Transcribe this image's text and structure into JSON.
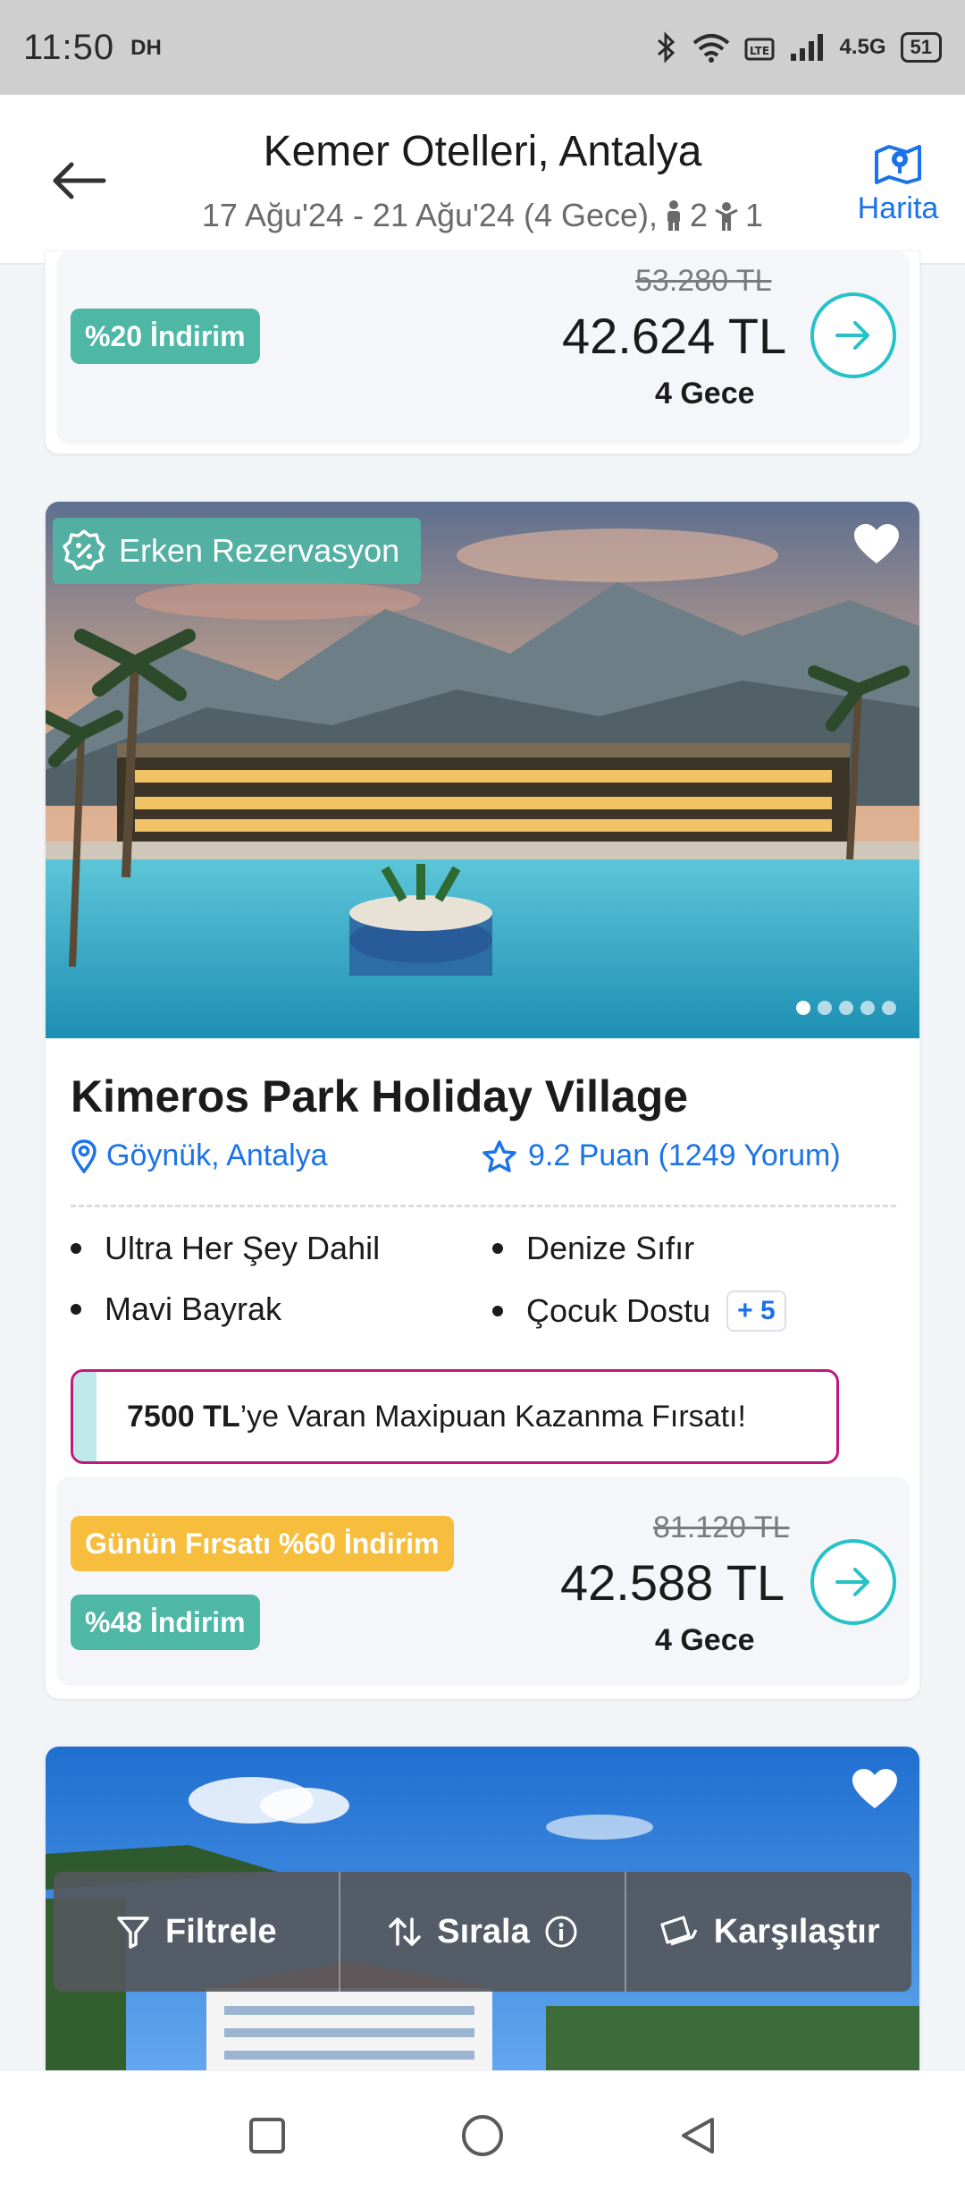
{
  "status_bar": {
    "time": "11:50",
    "carrier": "DH",
    "network": "4.5G",
    "battery": "51"
  },
  "header": {
    "title": "Kemer Otelleri, Antalya",
    "dates": "17 Ağu'24 - 21 Ağu'24 (4 Gece),",
    "adults": "2",
    "children": "1",
    "map_label": "Harita"
  },
  "top_card": {
    "discount": "%20 İndirim",
    "old_price": "53.280 TL",
    "price": "42.624 TL",
    "nights": "4 Gece"
  },
  "hotel_card": {
    "early_booking": "Erken Rezervasyon",
    "name": "Kimeros Park Holiday Village",
    "location": "Göynük, Antalya",
    "rating": "9.2 Puan (1249 Yorum)",
    "features": [
      "Ultra Her Şey Dahil",
      "Denize Sıfır",
      "Mavi Bayrak",
      "Çocuk Dostu"
    ],
    "more_features": "+ 5",
    "maxipuan_amount": "7500 TL",
    "maxipuan_text": "’ye Varan Maxipuan Kazanma Fırsatı!",
    "deal_badge": "Günün Fırsatı %60 İndirim",
    "discount": "%48 İndirim",
    "old_price": "81.120 TL",
    "price": "42.588 TL",
    "nights": "4 Gece"
  },
  "bottom_bar": {
    "filter": "Filtrele",
    "sort": "Sırala",
    "compare": "Karşılaştır"
  },
  "colors": {
    "accent_blue": "#1a73e8",
    "teal": "#4eb7a5",
    "cyan_button": "#26c2c8",
    "yellow": "#f6be3c",
    "maxipuan_border": "#c2187a"
  }
}
